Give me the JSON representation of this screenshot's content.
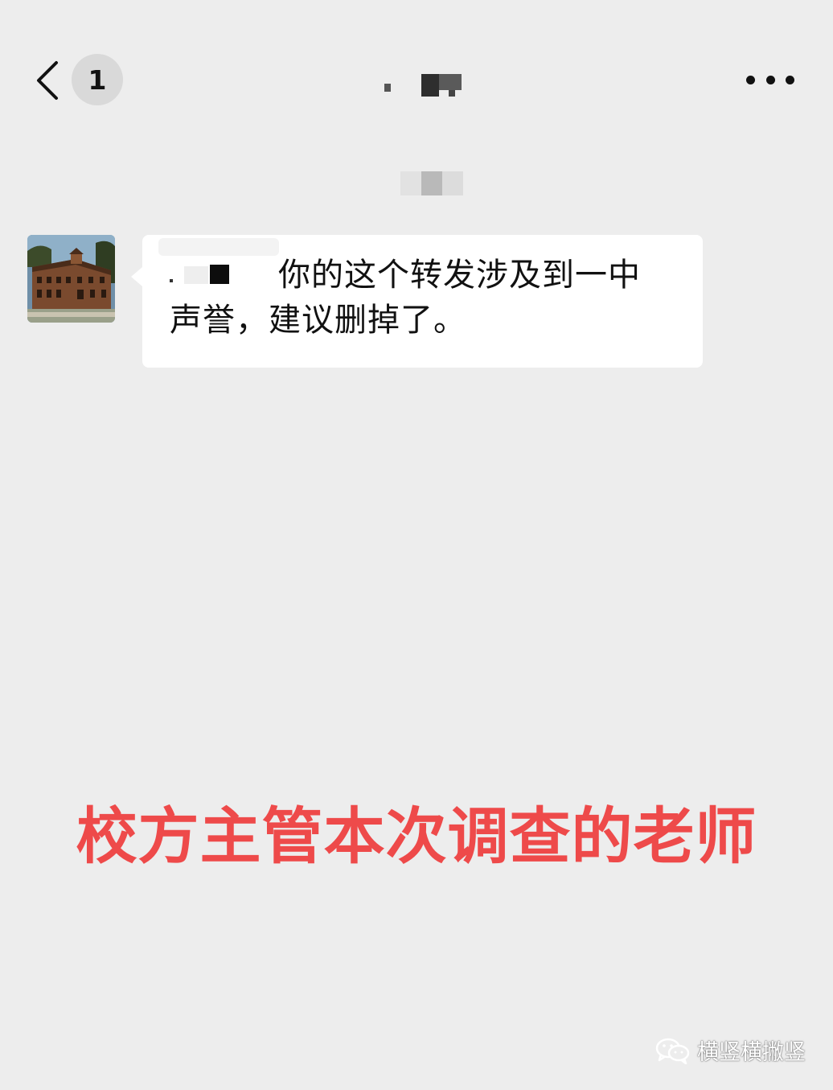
{
  "nav": {
    "unread_count": "1"
  },
  "message": {
    "line1": "你的这个转发涉及到一中",
    "line2": "声誉，建议删掉了。"
  },
  "caption": "校方主管本次调查的老师",
  "watermark": "横竖横撇竖",
  "icons": {
    "back": "chevron-left-icon",
    "more": "more-dots-icon",
    "watermark_logo": "wechat-logo-icon"
  },
  "colors": {
    "background": "#ededed",
    "bubble": "#ffffff",
    "caption": "#ee4a4a"
  }
}
